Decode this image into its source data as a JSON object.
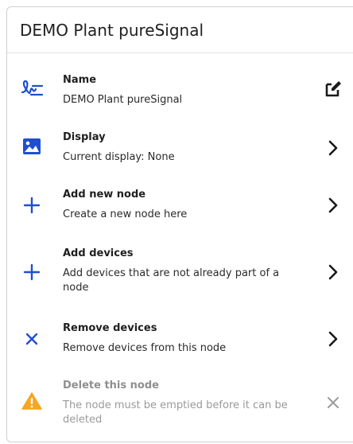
{
  "header": {
    "title": "DEMO Plant pureSignal"
  },
  "items": [
    {
      "title": "Name",
      "subtitle": "DEMO Plant pureSignal",
      "icon": "signature-icon",
      "action_icon": "edit-icon"
    },
    {
      "title": "Display",
      "subtitle": "Current display: None",
      "icon": "image-icon",
      "action_icon": "chevron-right-icon"
    },
    {
      "title": "Add new node",
      "subtitle": "Create a new node here",
      "icon": "plus-icon",
      "action_icon": "chevron-right-icon"
    },
    {
      "title": "Add devices",
      "subtitle": "Add devices that are not already part of a node",
      "icon": "plus-icon",
      "action_icon": "chevron-right-icon"
    },
    {
      "title": "Remove devices",
      "subtitle": "Remove devices from this node",
      "icon": "close-icon",
      "action_icon": "chevron-right-icon"
    },
    {
      "title": "Delete this node",
      "subtitle": "The node must be emptied before it can be deleted",
      "icon": "warning-icon",
      "action_icon": "close-icon",
      "disabled": true
    }
  ],
  "colors": {
    "accent": "#1f4fd1",
    "warning": "#f5a623",
    "disabled": "#9a9a9a"
  }
}
